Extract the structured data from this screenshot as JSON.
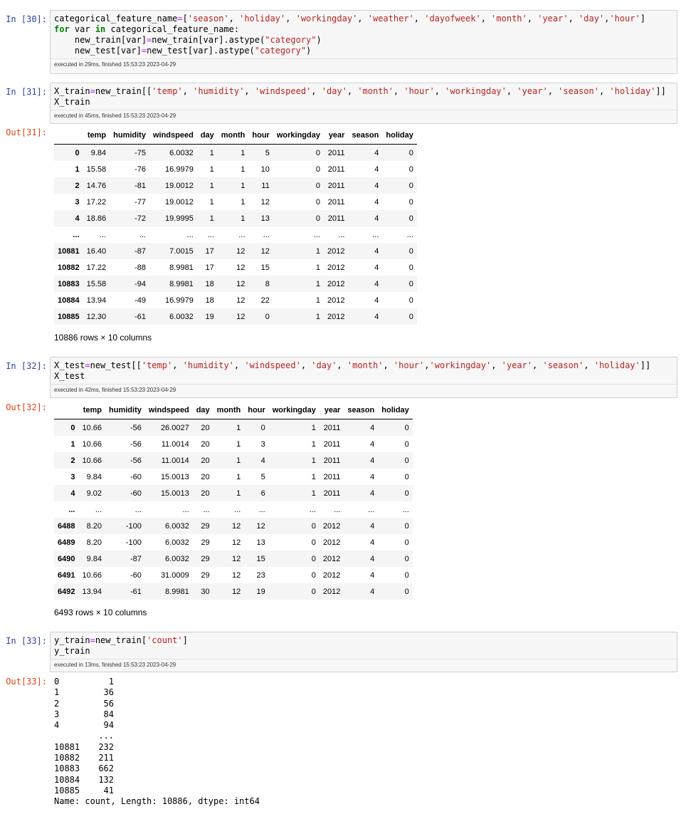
{
  "cells": [
    {
      "prompt": "In [30]:",
      "code_lines": [
        [
          [
            "",
            "categorical_feature_name"
          ],
          [
            "op",
            "="
          ],
          [
            "",
            "["
          ],
          [
            "str",
            "'season'"
          ],
          [
            "",
            ", "
          ],
          [
            "str",
            "'holiday'"
          ],
          [
            "",
            ", "
          ],
          [
            "str",
            "'workingday'"
          ],
          [
            "",
            ", "
          ],
          [
            "str",
            "'weather'"
          ],
          [
            "",
            ", "
          ],
          [
            "str",
            "'dayofweek'"
          ],
          [
            "",
            ", "
          ],
          [
            "str",
            "'month'"
          ],
          [
            "",
            ", "
          ],
          [
            "str",
            "'year'"
          ],
          [
            "",
            ", "
          ],
          [
            "str",
            "'day'"
          ],
          [
            "",
            ","
          ],
          [
            "str",
            "'hour'"
          ],
          [
            "",
            "]"
          ]
        ],
        [
          [
            "kw",
            "for"
          ],
          [
            "",
            " var "
          ],
          [
            "kw",
            "in"
          ],
          [
            "",
            " categorical_feature_name:"
          ]
        ],
        [
          [
            "",
            "    new_train[var]"
          ],
          [
            "op",
            "="
          ],
          [
            "",
            "new_train[var].astype("
          ],
          [
            "str",
            "\"category\""
          ],
          [
            "",
            ")"
          ]
        ],
        [
          [
            "",
            "    new_test[var]"
          ],
          [
            "op",
            "="
          ],
          [
            "",
            "new_test[var].astype("
          ],
          [
            "str",
            "\"category\""
          ],
          [
            "",
            ")"
          ]
        ]
      ],
      "exec": "executed in 29ms, finished 15:53:23 2023-04-29"
    },
    {
      "prompt": "In [31]:",
      "code_lines": [
        [
          [
            "",
            "X_train"
          ],
          [
            "op",
            "="
          ],
          [
            "",
            "new_train[["
          ],
          [
            "str",
            "'temp'"
          ],
          [
            "",
            ", "
          ],
          [
            "str",
            "'humidity'"
          ],
          [
            "",
            ", "
          ],
          [
            "str",
            "'windspeed'"
          ],
          [
            "",
            ", "
          ],
          [
            "str",
            "'day'"
          ],
          [
            "",
            ", "
          ],
          [
            "str",
            "'month'"
          ],
          [
            "",
            ", "
          ],
          [
            "str",
            "'hour'"
          ],
          [
            "",
            ", "
          ],
          [
            "str",
            "'workingday'"
          ],
          [
            "",
            ", "
          ],
          [
            "str",
            "'year'"
          ],
          [
            "",
            ", "
          ],
          [
            "str",
            "'season'"
          ],
          [
            "",
            ", "
          ],
          [
            "str",
            "'holiday'"
          ],
          [
            "",
            "]]"
          ]
        ],
        [
          [
            "",
            "X_train"
          ]
        ]
      ],
      "exec": "executed in 45ms, finished 15:53:23 2023-04-29",
      "out_prompt": "Out[31]:",
      "table": {
        "columns": [
          "temp",
          "humidity",
          "windspeed",
          "day",
          "month",
          "hour",
          "workingday",
          "year",
          "season",
          "holiday"
        ],
        "rows": [
          [
            "0",
            "9.84",
            "-75",
            "6.0032",
            "1",
            "1",
            "5",
            "0",
            "2011",
            "4",
            "0"
          ],
          [
            "1",
            "15.58",
            "-76",
            "16.9979",
            "1",
            "1",
            "10",
            "0",
            "2011",
            "4",
            "0"
          ],
          [
            "2",
            "14.76",
            "-81",
            "19.0012",
            "1",
            "1",
            "11",
            "0",
            "2011",
            "4",
            "0"
          ],
          [
            "3",
            "17.22",
            "-77",
            "19.0012",
            "1",
            "1",
            "12",
            "0",
            "2011",
            "4",
            "0"
          ],
          [
            "4",
            "18.86",
            "-72",
            "19.9995",
            "1",
            "1",
            "13",
            "0",
            "2011",
            "4",
            "0"
          ],
          [
            "...",
            "...",
            "...",
            "...",
            "...",
            "...",
            "...",
            "...",
            "...",
            "...",
            "..."
          ],
          [
            "10881",
            "16.40",
            "-87",
            "7.0015",
            "17",
            "12",
            "12",
            "1",
            "2012",
            "4",
            "0"
          ],
          [
            "10882",
            "17.22",
            "-88",
            "8.9981",
            "17",
            "12",
            "15",
            "1",
            "2012",
            "4",
            "0"
          ],
          [
            "10883",
            "15.58",
            "-94",
            "8.9981",
            "18",
            "12",
            "8",
            "1",
            "2012",
            "4",
            "0"
          ],
          [
            "10884",
            "13.94",
            "-49",
            "16.9979",
            "18",
            "12",
            "22",
            "1",
            "2012",
            "4",
            "0"
          ],
          [
            "10885",
            "12.30",
            "-61",
            "6.0032",
            "19",
            "12",
            "0",
            "1",
            "2012",
            "4",
            "0"
          ]
        ],
        "shape": "10886 rows × 10 columns"
      }
    },
    {
      "prompt": "In [32]:",
      "code_lines": [
        [
          [
            "",
            "X_test"
          ],
          [
            "op",
            "="
          ],
          [
            "",
            "new_test[["
          ],
          [
            "str",
            "'temp'"
          ],
          [
            "",
            ", "
          ],
          [
            "str",
            "'humidity'"
          ],
          [
            "",
            ", "
          ],
          [
            "str",
            "'windspeed'"
          ],
          [
            "",
            ", "
          ],
          [
            "str",
            "'day'"
          ],
          [
            "",
            ", "
          ],
          [
            "str",
            "'month'"
          ],
          [
            "",
            ", "
          ],
          [
            "str",
            "'hour'"
          ],
          [
            "",
            ","
          ],
          [
            "str",
            "'workingday'"
          ],
          [
            "",
            ", "
          ],
          [
            "str",
            "'year'"
          ],
          [
            "",
            ", "
          ],
          [
            "str",
            "'season'"
          ],
          [
            "",
            ", "
          ],
          [
            "str",
            "'holiday'"
          ],
          [
            "",
            "]]"
          ]
        ],
        [
          [
            "",
            "X_test"
          ]
        ]
      ],
      "exec": "executed in 42ms, finished 15:53:23 2023-04-29",
      "out_prompt": "Out[32]:",
      "table": {
        "columns": [
          "temp",
          "humidity",
          "windspeed",
          "day",
          "month",
          "hour",
          "workingday",
          "year",
          "season",
          "holiday"
        ],
        "rows": [
          [
            "0",
            "10.66",
            "-56",
            "26.0027",
            "20",
            "1",
            "0",
            "1",
            "2011",
            "4",
            "0"
          ],
          [
            "1",
            "10.66",
            "-56",
            "11.0014",
            "20",
            "1",
            "3",
            "1",
            "2011",
            "4",
            "0"
          ],
          [
            "2",
            "10.66",
            "-56",
            "11.0014",
            "20",
            "1",
            "4",
            "1",
            "2011",
            "4",
            "0"
          ],
          [
            "3",
            "9.84",
            "-60",
            "15.0013",
            "20",
            "1",
            "5",
            "1",
            "2011",
            "4",
            "0"
          ],
          [
            "4",
            "9.02",
            "-60",
            "15.0013",
            "20",
            "1",
            "6",
            "1",
            "2011",
            "4",
            "0"
          ],
          [
            "...",
            "...",
            "...",
            "...",
            "...",
            "...",
            "...",
            "...",
            "...",
            "...",
            "..."
          ],
          [
            "6488",
            "8.20",
            "-100",
            "6.0032",
            "29",
            "12",
            "12",
            "0",
            "2012",
            "4",
            "0"
          ],
          [
            "6489",
            "8.20",
            "-100",
            "6.0032",
            "29",
            "12",
            "13",
            "0",
            "2012",
            "4",
            "0"
          ],
          [
            "6490",
            "9.84",
            "-87",
            "6.0032",
            "29",
            "12",
            "15",
            "0",
            "2012",
            "4",
            "0"
          ],
          [
            "6491",
            "10.66",
            "-60",
            "31.0009",
            "29",
            "12",
            "23",
            "0",
            "2012",
            "4",
            "0"
          ],
          [
            "6492",
            "13.94",
            "-61",
            "8.9981",
            "30",
            "12",
            "19",
            "0",
            "2012",
            "4",
            "0"
          ]
        ],
        "shape": "6493 rows × 10 columns"
      }
    },
    {
      "prompt": "In [33]:",
      "code_lines": [
        [
          [
            "",
            "y_train"
          ],
          [
            "op",
            "="
          ],
          [
            "",
            "new_train["
          ],
          [
            "str",
            "'count'"
          ],
          [
            "",
            "]"
          ]
        ],
        [
          [
            "",
            "y_train"
          ]
        ]
      ],
      "exec": "executed in 13ms, finished 15:53:23 2023-04-29",
      "out_prompt": "Out[33]:",
      "series": {
        "rows": [
          [
            "0",
            "1"
          ],
          [
            "1",
            "36"
          ],
          [
            "2",
            "56"
          ],
          [
            "3",
            "84"
          ],
          [
            "4",
            "94"
          ],
          [
            "",
            "..."
          ],
          [
            "10881",
            "232"
          ],
          [
            "10882",
            "211"
          ],
          [
            "10883",
            "662"
          ],
          [
            "10884",
            "132"
          ],
          [
            "10885",
            "41"
          ]
        ],
        "footer": "Name: count, Length: 10886, dtype: int64"
      }
    }
  ]
}
